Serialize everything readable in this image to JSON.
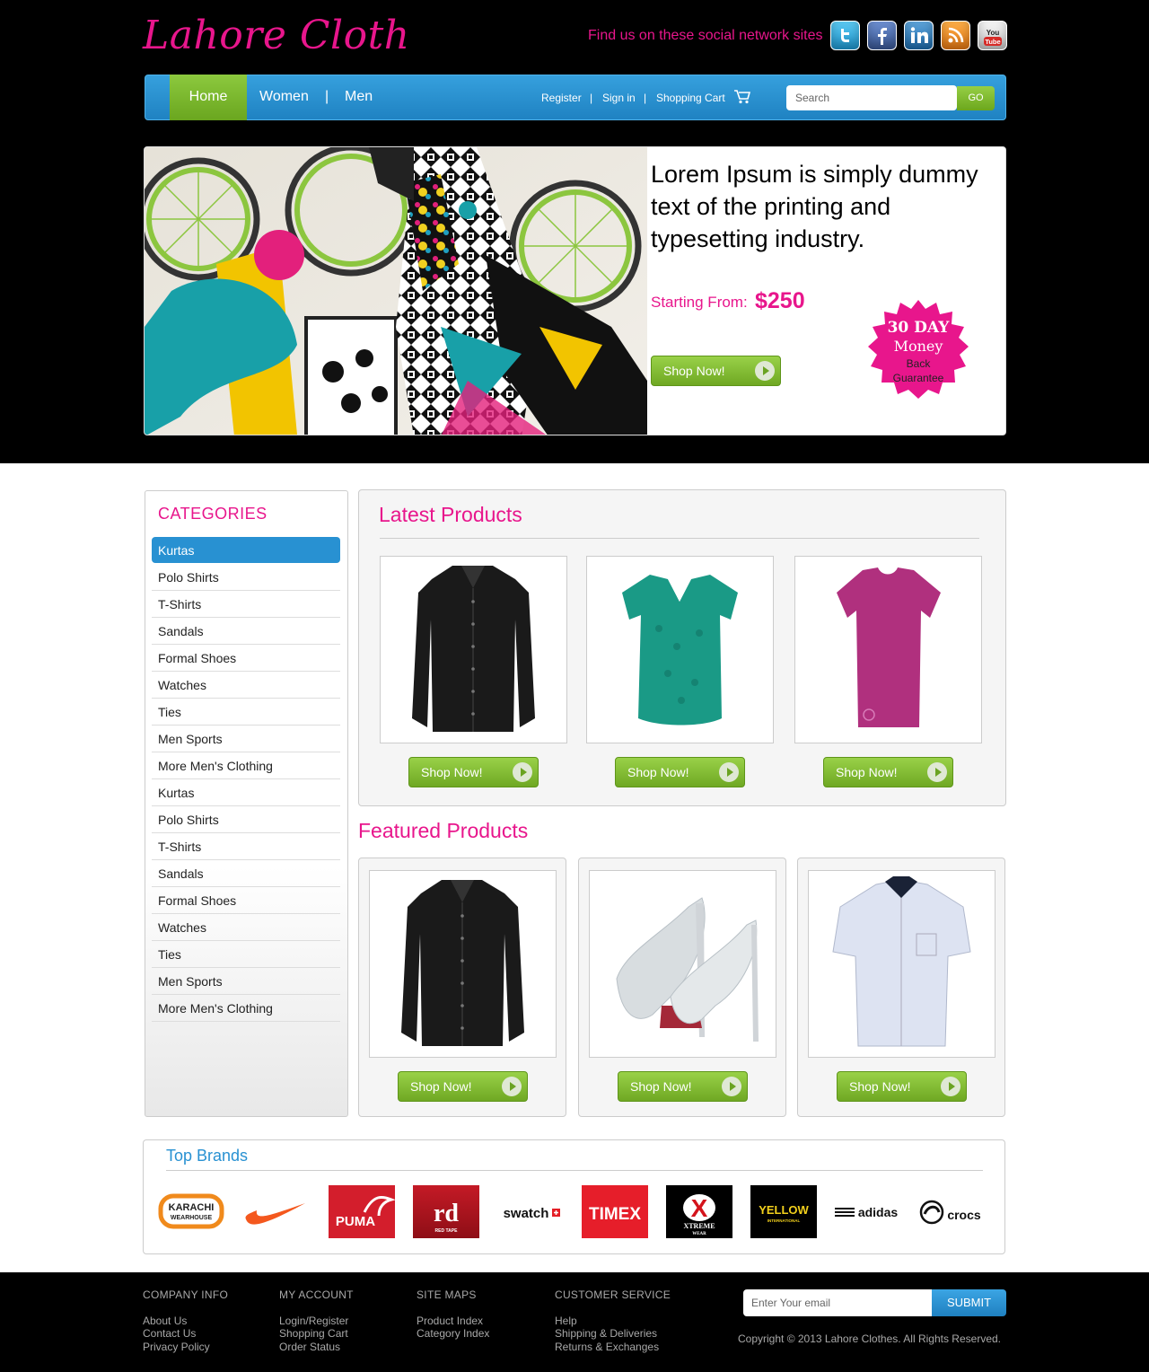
{
  "header": {
    "logo": "Lahore Cloth",
    "social_text": "Find us on these social network sites",
    "social_icons": [
      "twitter-icon",
      "facebook-icon",
      "linkedin-icon",
      "rss-icon",
      "youtube-icon"
    ],
    "youtube_label": "You Tube"
  },
  "nav": {
    "home": "Home",
    "women": "Women",
    "sep": "|",
    "men": "Men",
    "register": "Register",
    "signin": "Sign in",
    "cart": "Shopping Cart",
    "small_sep": "|",
    "search_placeholder": "Search",
    "go": "GO"
  },
  "banner": {
    "text": "Lorem Ipsum is simply dummy text of the printing and typesetting industry.",
    "starting_from": "Starting From:",
    "price": "$250",
    "button": "Shop Now!",
    "badge": {
      "line1": "30 DAY",
      "line2": "Money",
      "line3": "Back",
      "line4": "Guarantee"
    }
  },
  "sidebar": {
    "title": "CATEGORIES",
    "items": [
      "Kurtas",
      "Polo Shirts",
      "T-Shirts",
      "Sandals",
      "Formal Shoes",
      "Watches",
      "Ties",
      "Men Sports",
      "More Men's Clothing",
      "Kurtas",
      "Polo Shirts",
      "T-Shirts",
      "Sandals",
      "Formal Shoes",
      "Watches",
      "Ties",
      "Men Sports",
      "More Men's Clothing"
    ],
    "active_index": 0
  },
  "latest": {
    "title": "Latest Products",
    "products": [
      {
        "name": "black-shirt",
        "button": "Shop Now!"
      },
      {
        "name": "teal-lace-top",
        "button": "Shop Now!"
      },
      {
        "name": "magenta-tshirt",
        "button": "Shop Now!"
      }
    ]
  },
  "featured": {
    "title": "Featured Products",
    "products": [
      {
        "name": "black-shirt",
        "button": "Shop Now!"
      },
      {
        "name": "glitter-heels",
        "button": "Shop Now!"
      },
      {
        "name": "white-short-sleeve-shirt",
        "button": "Shop Now!"
      }
    ]
  },
  "brands": {
    "title": "Top Brands",
    "items": [
      "KARACHI WEARHOUSE",
      "nike",
      "PUMA",
      "rd",
      "swatch",
      "TIMEX",
      "XTREME WEAR",
      "YELLOW",
      "adidas",
      "crocs"
    ],
    "karachi_line1": "KARACHI",
    "karachi_line2": "WEARHOUSE",
    "rd_sub": "RED TAPE",
    "xtreme_x": "X",
    "xtreme_text": "XTREME",
    "xtreme_sub": "WEAR",
    "yellow_sub": "INTERNATIONAL"
  },
  "footer": {
    "columns": [
      {
        "heading": "COMPANY INFO",
        "links": [
          "About Us",
          "Contact Us",
          "Privacy Policy"
        ]
      },
      {
        "heading": "MY ACCOUNT",
        "links": [
          "Login/Register",
          "Shopping Cart",
          "Order Status"
        ]
      },
      {
        "heading": "SITE MAPS",
        "links": [
          "Product Index",
          "Category Index"
        ]
      },
      {
        "heading": "CUSTOMER SERVICE",
        "links": [
          "Help",
          "Shipping & Deliveries",
          "Returns & Exchanges"
        ]
      }
    ],
    "email_placeholder": "Enter Your email",
    "submit": "SUBMIT",
    "copyright": "Copyright © 2013 Lahore Clothes. All Rights Reserved."
  },
  "colors": {
    "pink": "#e8168c",
    "blue": "#2891d2",
    "green": "#7ab82f"
  }
}
